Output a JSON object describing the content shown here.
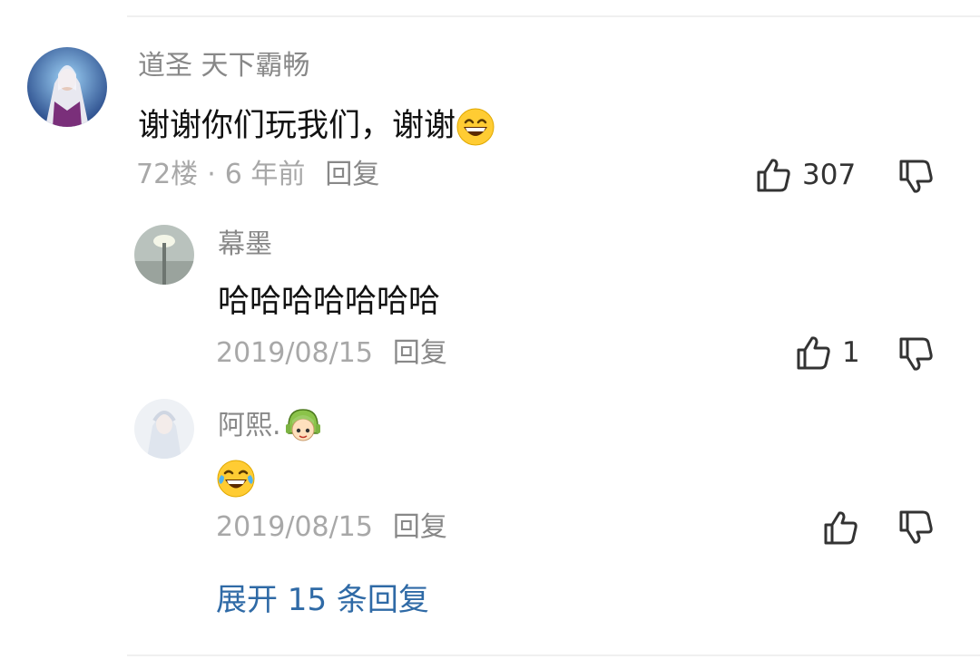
{
  "colors": {
    "link": "#2f6aa6",
    "meta": "#a8a8a8",
    "name": "#888888",
    "text": "#111111"
  },
  "comment": {
    "username": "道圣 天下霸畅",
    "text": "谢谢你们玩我们，谢谢",
    "text_emoji": "grinning-face-emoji",
    "floor": "72楼",
    "time": "6 年前",
    "reply_label": "回复",
    "likes": "307",
    "avatar_icon": "white-haired-warrior-avatar"
  },
  "replies": [
    {
      "username": "幕墨",
      "text": "哈哈哈哈哈哈哈",
      "date": "2019/08/15",
      "reply_label": "回复",
      "likes": "1",
      "avatar_icon": "streetlight-avatar"
    },
    {
      "username": "阿熙.",
      "username_badge": "green-hair-character-badge",
      "text_emoji": "face-with-tears-of-joy-emoji",
      "date": "2019/08/15",
      "reply_label": "回复",
      "likes": "",
      "avatar_icon": "pale-anime-avatar"
    }
  ],
  "expand_label": "展开 15 条回复"
}
